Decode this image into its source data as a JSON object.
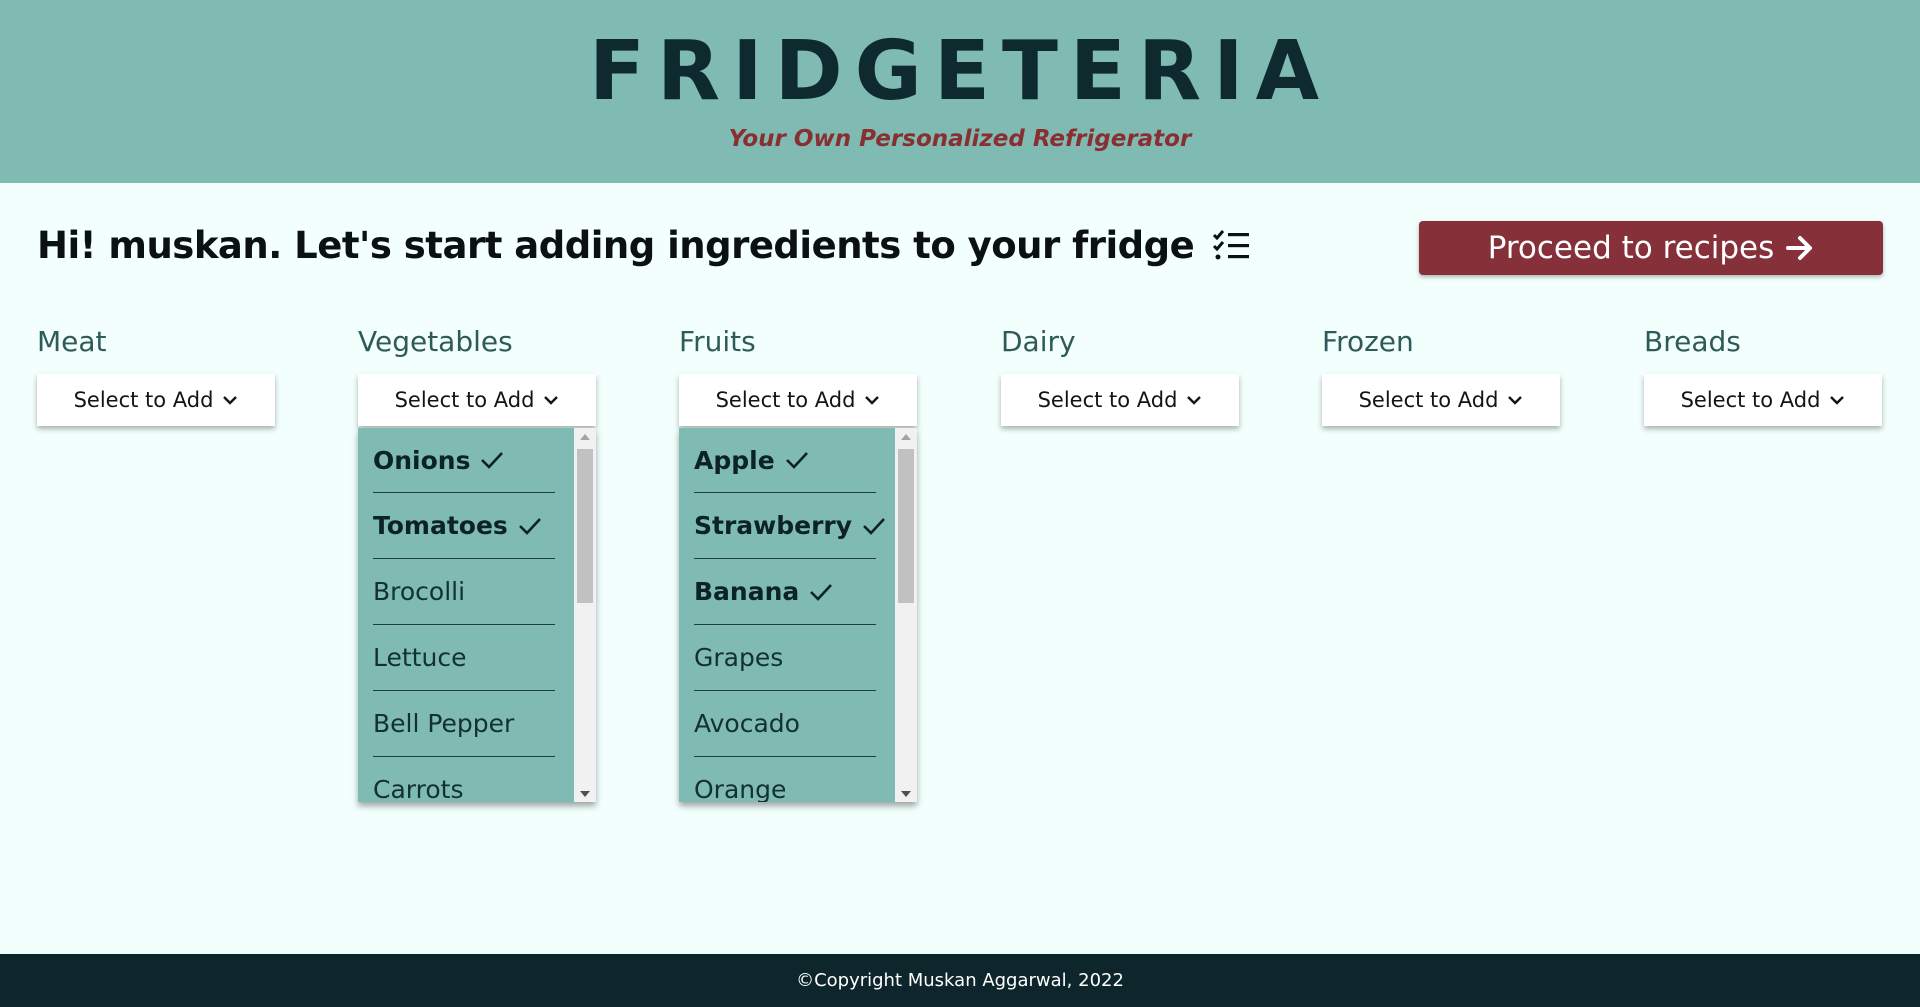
{
  "header": {
    "brand": "FRIDGETERIA",
    "tagline": "Your Own Personalized Refrigerator"
  },
  "greeting": {
    "text": "Hi! muskan. Let's start adding ingredients to your fridge",
    "icon": "checklist-icon"
  },
  "proceed_button": {
    "label": "Proceed to recipes",
    "icon": "arrow-right-icon"
  },
  "categories": [
    {
      "label": "Meat",
      "select_label": "Select to Add"
    },
    {
      "label": "Vegetables",
      "select_label": "Select to Add",
      "items": [
        {
          "label": "Onions",
          "selected": true
        },
        {
          "label": "Tomatoes",
          "selected": true
        },
        {
          "label": "Brocolli",
          "selected": false
        },
        {
          "label": "Lettuce",
          "selected": false
        },
        {
          "label": "Bell Pepper",
          "selected": false
        },
        {
          "label": "Carrots",
          "selected": false
        }
      ]
    },
    {
      "label": "Fruits",
      "select_label": "Select to Add",
      "items": [
        {
          "label": "Apple",
          "selected": true
        },
        {
          "label": "Strawberry",
          "selected": true
        },
        {
          "label": "Banana",
          "selected": true
        },
        {
          "label": "Grapes",
          "selected": false
        },
        {
          "label": "Avocado",
          "selected": false
        },
        {
          "label": "Orange",
          "selected": false
        }
      ]
    },
    {
      "label": "Dairy",
      "select_label": "Select to Add"
    },
    {
      "label": "Frozen",
      "select_label": "Select to Add"
    },
    {
      "label": "Breads",
      "select_label": "Select to Add"
    }
  ],
  "footer": {
    "text": "©Copyright Muskan Aggarwal, 2022"
  },
  "colors": {
    "header_bg": "#7fbab3",
    "page_bg": "#f2fffc",
    "accent": "#86303a",
    "footer_bg": "#0e262b"
  }
}
